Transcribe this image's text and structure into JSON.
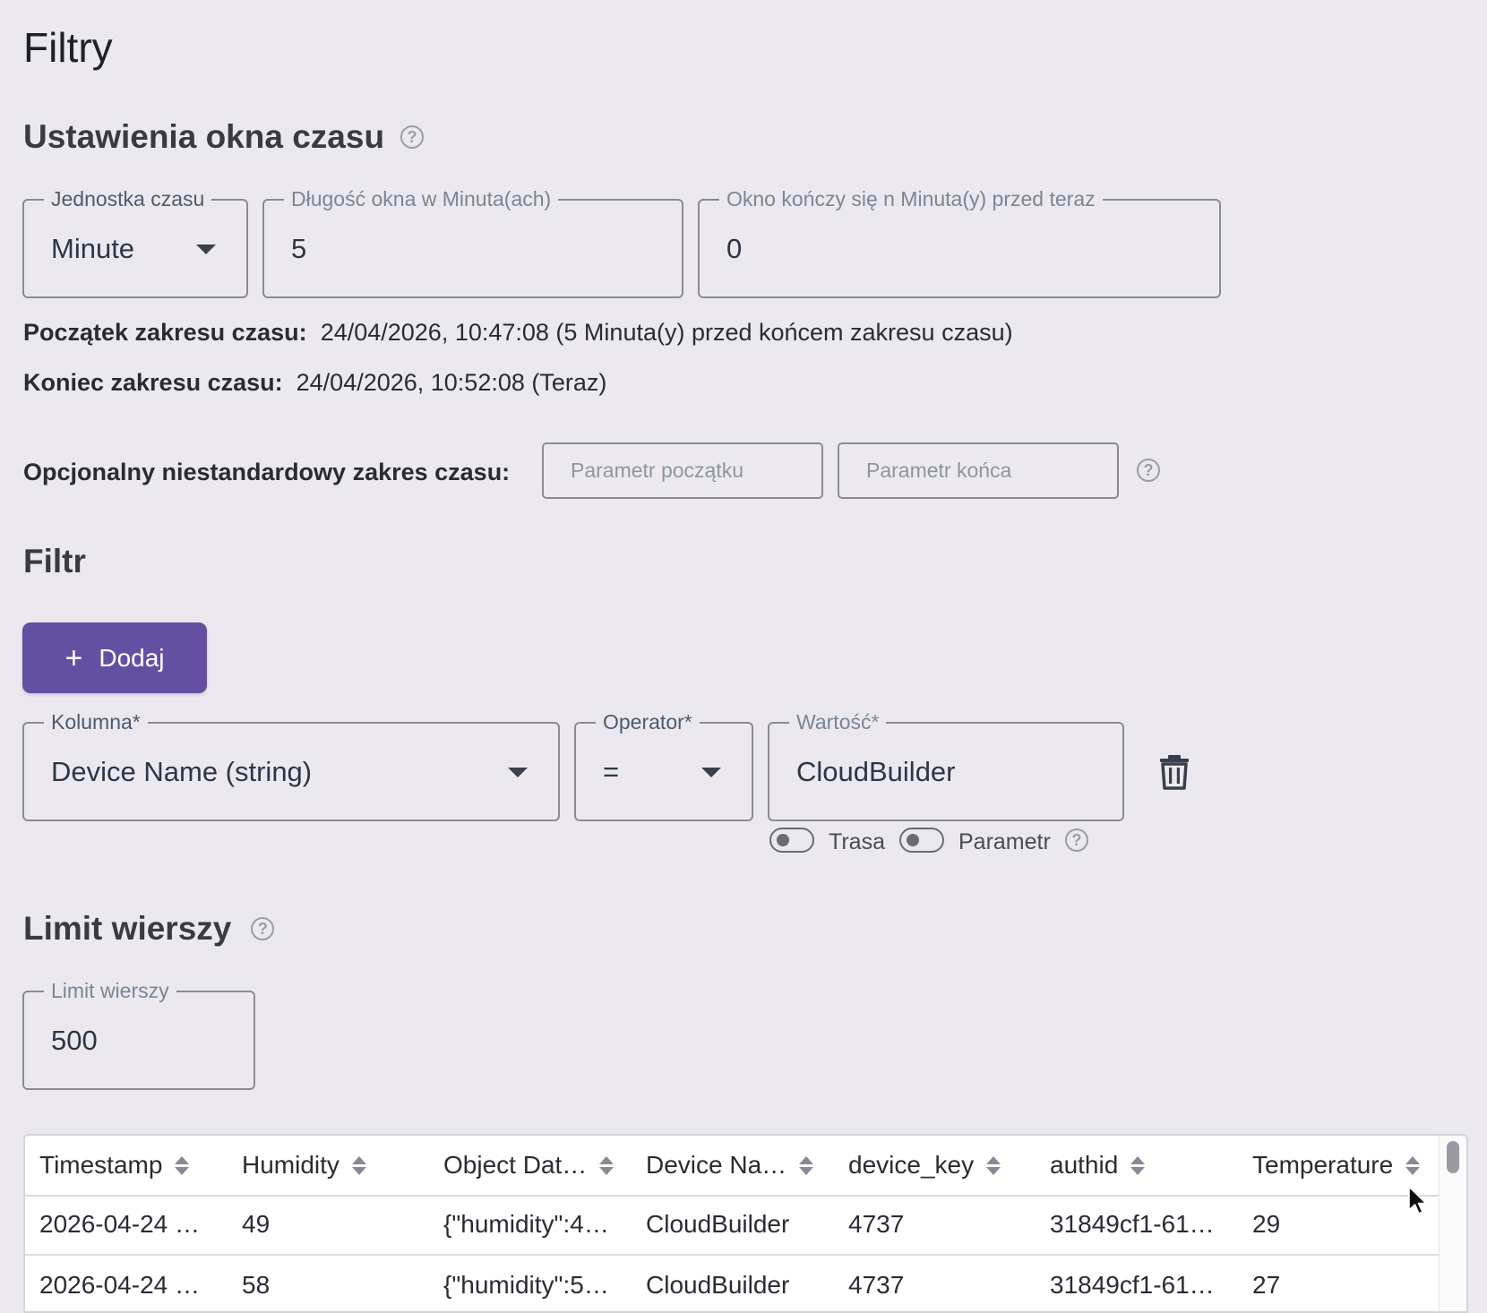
{
  "page": {
    "title": "Filtry"
  },
  "time_window": {
    "title": "Ustawienia okna czasu",
    "unit": {
      "label": "Jednostka czasu",
      "value": "Minute"
    },
    "length": {
      "label": "Długość okna w Minuta(ach)",
      "value": "5"
    },
    "offset": {
      "label": "Okno kończy się n Minuta(y) przed teraz",
      "value": "0"
    },
    "start": {
      "label": "Początek zakresu czasu:",
      "value": "24/04/2026, 10:47:08 (5 Minuta(y) przed końcem zakresu czasu)"
    },
    "end": {
      "label": "Koniec zakresu czasu:",
      "value": "24/04/2026, 10:52:08 (Teraz)"
    },
    "custom": {
      "label": "Opcjonalny niestandardowy zakres czasu:",
      "start_placeholder": "Parametr początku",
      "end_placeholder": "Parametr końca"
    }
  },
  "filter": {
    "title": "Filtr",
    "add_label": "Dodaj",
    "column": {
      "label": "Kolumna*",
      "value": "Device Name (string)"
    },
    "operator": {
      "label": "Operator*",
      "value": "="
    },
    "value": {
      "label": "Wartość*",
      "value": "CloudBuilder"
    },
    "toggle_route_label": "Trasa",
    "toggle_param_label": "Parametr"
  },
  "row_limit": {
    "title": "Limit wierszy",
    "label": "Limit wierszy",
    "value": "500"
  },
  "table": {
    "columns": [
      "Timestamp",
      "Humidity",
      "Object Dat…",
      "Device Na…",
      "device_key",
      "authid",
      "Temperature"
    ],
    "rows": [
      [
        "2026-04-24 …",
        "49",
        "{\"humidity\":4…",
        "CloudBuilder",
        "4737",
        "31849cf1-61…",
        "29"
      ],
      [
        "2026-04-24 …",
        "58",
        "{\"humidity\":5…",
        "CloudBuilder",
        "4737",
        "31849cf1-61…",
        "27"
      ]
    ]
  }
}
